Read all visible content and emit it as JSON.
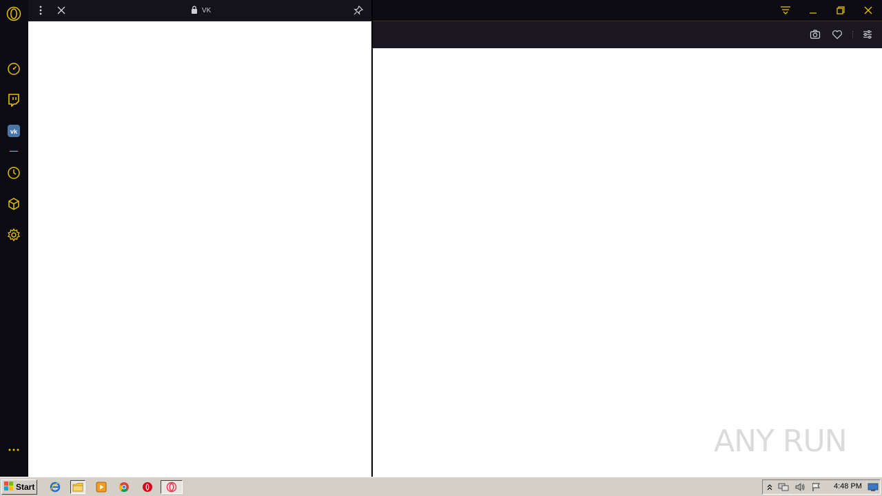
{
  "panel": {
    "title": "VK"
  },
  "taskbar": {
    "start_label": "Start",
    "clock": "4:48 PM"
  },
  "watermark": {
    "text": "ANY RUN"
  },
  "icons": {
    "sidebar": [
      "opera-gx-logo-icon",
      "speed-dial-icon",
      "twitch-icon",
      "vk-icon",
      "history-icon",
      "extensions-cube-icon",
      "settings-gear-icon",
      "more-dots-icon"
    ],
    "panel_header": [
      "menu-kebab-icon",
      "close-icon",
      "lock-icon",
      "pin-icon"
    ],
    "window": [
      "easy-setup-icon",
      "minimize-icon",
      "restore-icon",
      "close-window-icon"
    ],
    "toolbar": [
      "snapshot-camera-icon",
      "bookmark-heart-icon",
      "easy-setup-sliders-icon"
    ]
  },
  "colors": {
    "accent": "#e5c000",
    "sidebar_bg": "#0c0b12",
    "toolbar_bg": "#1a1720",
    "taskbar_bg": "#d4d0c8"
  }
}
